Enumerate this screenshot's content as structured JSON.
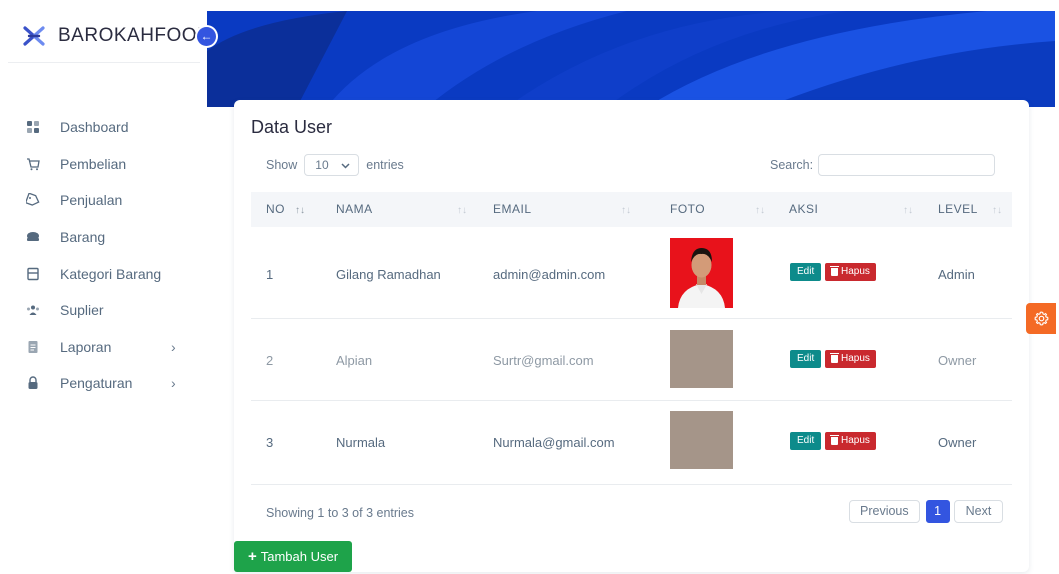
{
  "brand": {
    "name": "BAROKAHFOOD"
  },
  "sidebar": {
    "items": [
      {
        "label": "Dashboard",
        "icon": "dashboard-icon",
        "has_submenu": false
      },
      {
        "label": "Pembelian",
        "icon": "cart-icon",
        "has_submenu": false
      },
      {
        "label": "Penjualan",
        "icon": "sale-tag-icon",
        "has_submenu": false
      },
      {
        "label": "Barang",
        "icon": "box-icon",
        "has_submenu": false
      },
      {
        "label": "Kategori Barang",
        "icon": "category-icon",
        "has_submenu": false
      },
      {
        "label": "Suplier",
        "icon": "group-icon",
        "has_submenu": false
      },
      {
        "label": "Laporan",
        "icon": "report-icon",
        "has_submenu": true
      },
      {
        "label": "Pengaturan",
        "icon": "lock-icon",
        "has_submenu": true
      }
    ]
  },
  "card": {
    "title": "Data User",
    "length": {
      "show_label": "Show",
      "value": "10",
      "entries_label": "entries"
    },
    "search": {
      "label": "Search:",
      "value": ""
    },
    "columns": [
      "NO",
      "NAMA",
      "EMAIL",
      "FOTO",
      "AKSI",
      "LEVEL"
    ],
    "rows": [
      {
        "no": "1",
        "nama": "Gilang Ramadhan",
        "email": "admin@admin.com",
        "foto": "portrait-photo",
        "level": "Admin"
      },
      {
        "no": "2",
        "nama": "Alpian",
        "email": "Surtr@gmail.com",
        "foto": "placeholder-photo",
        "level": "Owner"
      },
      {
        "no": "3",
        "nama": "Nurmala",
        "email": "Nurmala@gmail.com",
        "foto": "placeholder-photo",
        "level": "Owner"
      }
    ],
    "actions": {
      "edit_label": "Edit",
      "delete_label": "Hapus"
    },
    "info": "Showing 1 to 3 of 3 entries",
    "pagination": {
      "previous": "Previous",
      "current": "1",
      "next": "Next"
    }
  },
  "add_button": {
    "label": "Tambah User"
  },
  "colors": {
    "primary": "#3355e0",
    "banner": "#0a3ac2",
    "edit": "#0d8b8b",
    "delete": "#c9292e",
    "add": "#1ea34a",
    "settings_tab": "#f46a25",
    "photo_red": "#e8121b",
    "photo_placeholder": "#a59589"
  }
}
